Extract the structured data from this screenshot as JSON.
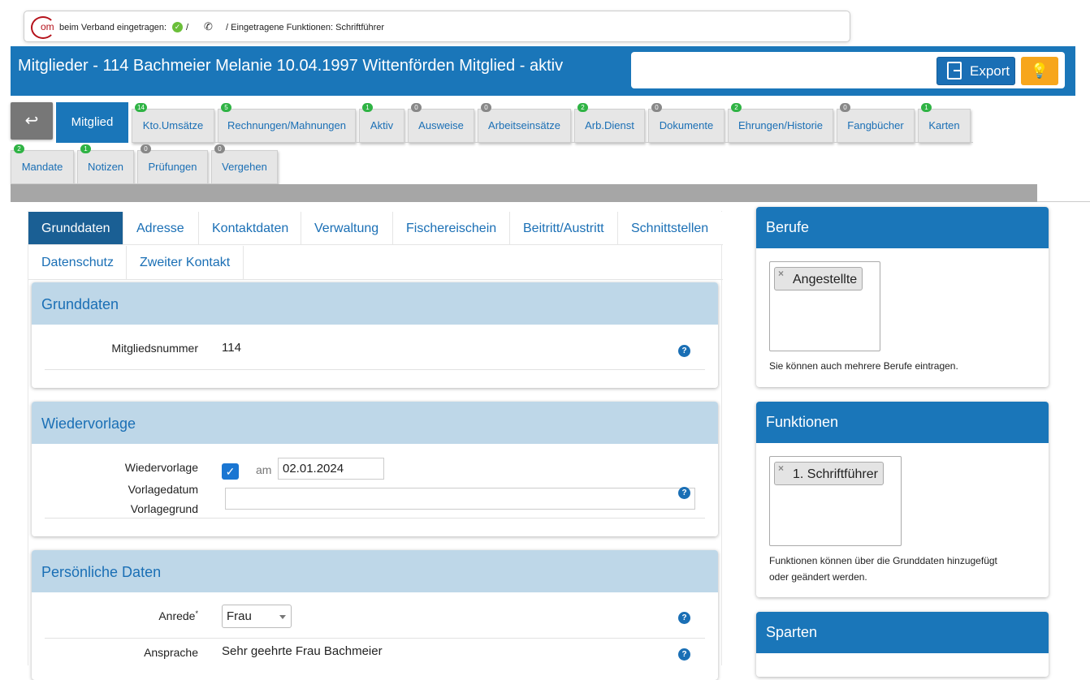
{
  "topbar": {
    "logo_text": "om",
    "registered_label": "beim Verband eingetragen:",
    "slash": "/",
    "functions_label": "/ Eingetragene Funktionen: Schriftführer"
  },
  "header": {
    "title": "Mitglieder - 114 Bachmeier Melanie 10.04.1997 Wittenförden Mitglied - aktiv",
    "export_label": "Export"
  },
  "main_tabs": {
    "active": "Mitglied",
    "row1": [
      {
        "label": "Kto.Umsätze",
        "badge": "14",
        "status": "green"
      },
      {
        "label": "Rechnungen/Mahnungen",
        "badge": "5",
        "status": "green"
      },
      {
        "label": "Aktiv",
        "badge": "1",
        "status": "green"
      },
      {
        "label": "Ausweise",
        "badge": "0",
        "status": "gray"
      },
      {
        "label": "Arbeitseinsätze",
        "badge": "0",
        "status": "gray"
      },
      {
        "label": "Arb.Dienst",
        "badge": "2",
        "status": "green"
      },
      {
        "label": "Dokumente",
        "badge": "0",
        "status": "gray"
      },
      {
        "label": "Ehrungen/Historie",
        "badge": "2",
        "status": "green"
      },
      {
        "label": "Fangbücher",
        "badge": "0",
        "status": "gray"
      },
      {
        "label": "Karten",
        "badge": "1",
        "status": "green"
      }
    ],
    "row2": [
      {
        "label": "Mandate",
        "badge": "2",
        "status": "green"
      },
      {
        "label": "Notizen",
        "badge": "1",
        "status": "green"
      },
      {
        "label": "Prüfungen",
        "badge": "0",
        "status": "gray"
      },
      {
        "label": "Vergehen",
        "badge": "0",
        "status": "gray"
      }
    ]
  },
  "sub_tabs": [
    "Grunddaten",
    "Adresse",
    "Kontaktdaten",
    "Verwaltung",
    "Fischereischein",
    "Beitritt/Austritt",
    "Schnittstellen",
    "Datenschutz",
    "Zweiter Kontakt"
  ],
  "grunddaten": {
    "title": "Grunddaten",
    "mitgliedsnummer_label": "Mitgliedsnummer",
    "mitgliedsnummer_value": "114"
  },
  "wiedervorlage": {
    "title": "Wiedervorlage",
    "wiedervorlage_label": "Wiedervorlage",
    "checked": true,
    "am_label": "am",
    "date": "02.01.2024",
    "vorlagedatum_label": "Vorlagedatum",
    "vorlagegrund_label": "Vorlagegrund",
    "vorlagegrund_value": ""
  },
  "persoenlich": {
    "title": "Persönliche Daten",
    "anrede_label": "Anrede",
    "required_mark": "*",
    "anrede_value": "Frau",
    "ansprache_label": "Ansprache",
    "ansprache_value": "Sehr geehrte Frau Bachmeier"
  },
  "berufe": {
    "title": "Berufe",
    "tag": "Angestellte",
    "note": "Sie können auch mehrere Berufe eintragen."
  },
  "funktionen": {
    "title": "Funktionen",
    "tag": "1. Schriftführer",
    "note_line1": "Funktionen können über die Grunddaten hinzugefügt",
    "note_line2": "oder geändert werden."
  },
  "sparten": {
    "title": "Sparten"
  },
  "help_glyph": "?",
  "colors": {
    "primary": "#1a76b9",
    "panel_head": "#bed7e8",
    "badge_green": "#2fb344",
    "badge_gray": "#888888",
    "bulb": "#f7a61c"
  }
}
